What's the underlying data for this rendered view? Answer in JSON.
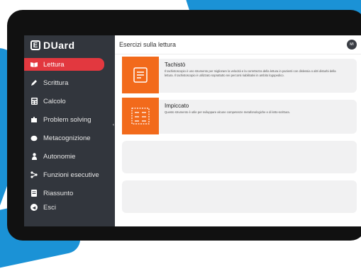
{
  "app": {
    "logo_letter": "E",
    "logo_text": "DUard"
  },
  "header": {
    "title": "Esercizi sulla lettura",
    "avatar_initials": "MI"
  },
  "sidebar": {
    "items": [
      {
        "label": "Lettura",
        "icon": "book-icon",
        "active": true
      },
      {
        "label": "Scrittura",
        "icon": "pencil-icon"
      },
      {
        "label": "Calcolo",
        "icon": "calculator-icon"
      },
      {
        "label": "Problem solving",
        "icon": "puzzle-icon"
      },
      {
        "label": "Metacognizione",
        "icon": "brain-icon"
      },
      {
        "label": "Autonomie",
        "icon": "person-icon"
      },
      {
        "label": "Funzioni esecutive",
        "icon": "network-icon"
      },
      {
        "label": "Riassunto",
        "icon": "document-icon"
      }
    ],
    "logout_label": "Esci"
  },
  "cards": [
    {
      "title": "Tachistò",
      "description": "Il tachistoscopio è uno strumento per migliorare la velocità e la correttezza della lettura in pazienti con dislessia o altri disturbi della lettura. Il tachistoscopio è utilizzato soprattutto nei percorsi riabilitativi in ambito logopedico.",
      "icon": "tachisto-icon"
    },
    {
      "title": "Impiccato",
      "description": "Questo strumento è utile per sviluppare alcune competenze metafonologiche e di letto-scrittura.",
      "icon": "word-grid-icon"
    }
  ],
  "colors": {
    "accent_red": "#e2383f",
    "card_orange": "#f26a1b",
    "sidebar": "#32363d",
    "background_blue": "#1b92d6"
  }
}
